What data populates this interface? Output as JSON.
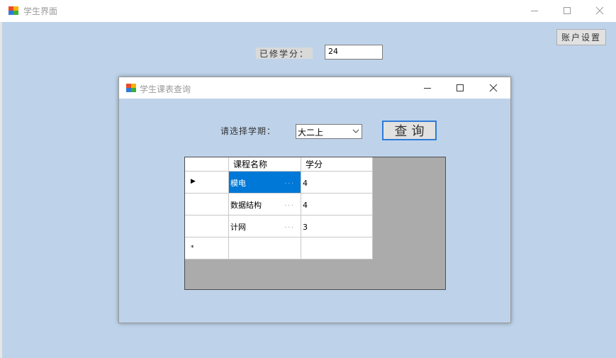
{
  "main_window": {
    "title": "学生界面",
    "account_button": "账户设置",
    "credits_label": "已修学分：",
    "credits_value": "24",
    "controls": {
      "minimize": "—",
      "maximize": "☐",
      "close": "✕"
    }
  },
  "dialog": {
    "title": "学生课表查询",
    "semester_label": "请选择学期：",
    "semester_value": "大二上",
    "query_button": "查询",
    "grid": {
      "columns": [
        "课程名称",
        "学分"
      ],
      "rows": [
        {
          "name": "模电",
          "credit": "4",
          "selected": true
        },
        {
          "name": "数据结构",
          "credit": "4",
          "selected": false
        },
        {
          "name": "计网",
          "credit": "3",
          "selected": false
        }
      ],
      "current_row_marker": "▶",
      "new_row_marker": "*"
    }
  }
}
